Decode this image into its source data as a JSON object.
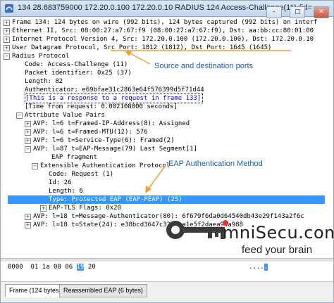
{
  "window": {
    "title": "134 28.683759000 172.20.0.100 172.20.0.10 RADIUS 124 Access-Challenge(11) (id=",
    "buttons": {
      "minimize": "–",
      "maximize": "□",
      "close": "✕"
    }
  },
  "tree": {
    "frame": "Frame 134: 124 bytes on wire (992 bits), 124 bytes captured (992 bits) on interf",
    "ethernet": "Ethernet II, Src: 08:00:27:a7:67:f9 (08:00:27:a7:67:f9), Dst: aa:bb:cc:80:01:00",
    "ip": "Internet Protocol Version 4, Src: 172.20.0.100 (172.20.0.100), Dst: 172.20.0.10",
    "udp": "User Datagram Protocol, Src Port: 1812 (1812), Dst Port: 1645 (1645)",
    "radius": "Radius Protocol",
    "code": "Code: Access-Challenge (11)",
    "packet_id": "Packet identifier: 0x25 (37)",
    "length": "Length: 82",
    "authenticator": "Authenticator: e69bfae31c2863e64f576399d5f71d44",
    "response_link": "[This is a response to a request in frame 133]",
    "time_from_request": "[Time from request: 0.002108000 seconds]",
    "avp_pairs": "Attribute Value Pairs",
    "avp1": "AVP: l=6  t=Framed-IP-Address(8): Assigned",
    "avp2": "AVP: l=6  t=Framed-MTU(12): 576",
    "avp3": "AVP: l=6  t=Service-Type(6): Framed(2)",
    "avp4": "AVP: l=87 t=EAP-Message(79) Last Segment[1]",
    "eap_fragment": "EAP fragment",
    "eap": "Extensible Authentication Protocol",
    "eap_code": "Code: Request (1)",
    "eap_id": "Id: 26",
    "eap_length": "Length: 6",
    "eap_type": "Type: Protected EAP (EAP-PEAP) (25)",
    "eap_tls_flags": "EAP-TLS Flags: 0x20",
    "avp5": "AVP: l=18 t=Message-Authenticator(80): 6f679f6da0d64540db43e29f143a2f6c",
    "avp6": "AVP: l=18 t=State(24): e38bcd3647c322baa1e5f2daea94a988"
  },
  "annotations": {
    "ports": "Source and destination ports",
    "eap_method": "EAP Authentication Method"
  },
  "logo": {
    "text": "mniSecu.com",
    "tagline": "feed your brain",
    "colors": {
      "key": "#3a3a3a",
      "text": "#231f20",
      "dot": "#e6332a"
    }
  },
  "hex": {
    "offset": "0000",
    "bytes_before": "01 1a 00 06",
    "selected_byte": "19",
    "bytes_after": "20",
    "ascii_before": "....",
    "ascii_selected": ".",
    "ascii_after": ""
  },
  "tabs": [
    {
      "label": "Frame (124 bytes)"
    },
    {
      "label": "Reassembled EAP (6 bytes)"
    }
  ],
  "icons": {
    "expand": "+",
    "collapse": "−"
  },
  "colors": {
    "selection": "#3399ff",
    "annotation": "#1e5ca8",
    "arrow": "#f0a030"
  }
}
